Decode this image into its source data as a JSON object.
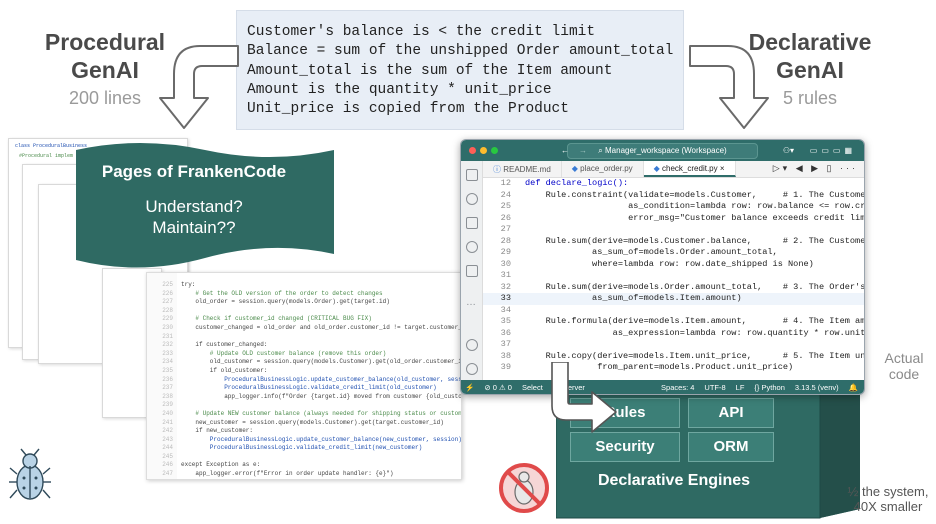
{
  "rules": [
    "Customer's balance is < the credit limit",
    "Balance = sum of the unshipped Order amount_total",
    "Amount_total is the sum of the Item amount",
    "Amount is the quantity * unit_price",
    "Unit_price is copied from the Product"
  ],
  "procedural": {
    "title1": "Procedural",
    "title2": "GenAI",
    "count": "200 lines"
  },
  "declarative": {
    "title1": "Declarative",
    "title2": "GenAI",
    "count": "5 rules"
  },
  "banner": {
    "title": "Pages of FrankenCode",
    "q1": "Understand?",
    "q2": "Maintain??"
  },
  "page_snippet": {
    "class_line": "class ProceduralBusiness",
    "impl_line": "#Procedural implem"
  },
  "procedural_code": {
    "gutter": [
      "225",
      "226",
      "227",
      "228",
      "229",
      "230",
      "231",
      "232",
      "233",
      "234",
      "235",
      "236",
      "237",
      "238",
      "239",
      "240",
      "241",
      "242",
      "243",
      "244",
      "245",
      "246",
      "247",
      "248",
      "249",
      "250",
      "251",
      "252"
    ],
    "lines": [
      "try:",
      "    # Get the OLD version of the order to detect changes",
      "    old_order = session.query(models.Order).get(target.id)",
      "",
      "    # Check if customer_id changed (CRITICAL BUG FIX)",
      "    customer_changed = old_order and old_order.customer_id != target.customer_id",
      "",
      "    if customer_changed:",
      "        # Update OLD customer balance (remove this order)",
      "        old_customer = session.query(models.Customer).get(old_order.customer_id)",
      "        if old_customer:",
      "            ProceduralBusinessLogic.update_customer_balance(old_customer, session)",
      "            ProceduralBusinessLogic.validate_credit_limit(old_customer)",
      "            app_logger.info(f\"Order {target.id} moved from customer {old_customer.id} to",
      "",
      "    # Update NEW customer balance (always needed for shipping status or customer changes)",
      "    new_customer = session.query(models.Customer).get(target.customer_id)",
      "    if new_customer:",
      "        ProceduralBusinessLogic.update_customer_balance(new_customer, session)",
      "        ProceduralBusinessLogic.validate_credit_limit(new_customer)",
      "",
      "except Exception as e:",
      "    app_logger.error(f\"Error in order update handler: {e}\")",
      "    raise"
    ]
  },
  "ide": {
    "window_title": "Manager_workspace (Workspace)",
    "tabs": [
      "README.md",
      "place_order.py",
      "check_credit.py"
    ],
    "active_tab": "check_credit.py",
    "rows": [
      {
        "n": "12",
        "t": "def declare_logic():"
      },
      {
        "n": "24",
        "t": "    Rule.constraint(validate=models.Customer,     # 1. The Customer's balan"
      },
      {
        "n": "25",
        "t": "                    as_condition=lambda row: row.balance <= row.credit_lim"
      },
      {
        "n": "26",
        "t": "                    error_msg=\"Customer balance exceeds credit limit\")"
      },
      {
        "n": "27",
        "t": ""
      },
      {
        "n": "28",
        "t": "    Rule.sum(derive=models.Customer.balance,      # 2. The Customer's balan"
      },
      {
        "n": "29",
        "t": "             as_sum_of=models.Order.amount_total,"
      },
      {
        "n": "30",
        "t": "             where=lambda row: row.date_shipped is None)"
      },
      {
        "n": "31",
        "t": ""
      },
      {
        "n": "32",
        "t": "    Rule.sum(derive=models.Order.amount_total,    # 3. The Order's amount_"
      },
      {
        "n": "33",
        "t": "             as_sum_of=models.Item.amount)"
      },
      {
        "n": "34",
        "t": ""
      },
      {
        "n": "35",
        "t": "    Rule.formula(derive=models.Item.amount,       # 4. The Item amount is t"
      },
      {
        "n": "36",
        "t": "                 as_expression=lambda row: row.quantity * row.unit_price)"
      },
      {
        "n": "37",
        "t": ""
      },
      {
        "n": "38",
        "t": "    Rule.copy(derive=models.Item.unit_price,      # 5. The Item unit_price"
      },
      {
        "n": "39",
        "t": "              from_parent=models.Product.unit_price)"
      }
    ],
    "status": {
      "problems": "⊘ 0 ⚠ 0",
      "select": "Select",
      "server": "es Server",
      "spaces": "Spaces: 4",
      "enc": "UTF-8",
      "eol": "LF",
      "lang": "{} Python",
      "env": "3.13.5 (venv)"
    }
  },
  "engines": {
    "rules": "Rules",
    "api": "API",
    "security": "Security",
    "orm": "ORM",
    "title": "Declarative Engines"
  },
  "notes": {
    "actual1": "Actual",
    "actual2": "code",
    "half1": "½ the system,",
    "half2": "40X smaller"
  },
  "colors": {
    "teal": "#2f6a63",
    "teal_light": "#3c7f77",
    "rules_box": "#e8eef6"
  }
}
